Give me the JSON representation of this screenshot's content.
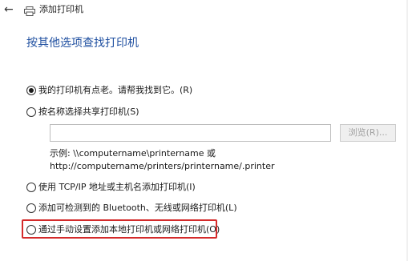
{
  "window": {
    "title": "添加打印机",
    "back_icon": "back-arrow-icon",
    "printer_icon": "printer-icon"
  },
  "heading": "按其他选项查找打印机",
  "options": [
    {
      "label": "我的打印机有点老。请帮我找到它。(R)",
      "checked": true
    },
    {
      "label": "按名称选择共享打印机(S)",
      "checked": false
    },
    {
      "label": "使用 TCP/IP 地址或主机名添加打印机(I)",
      "checked": false
    },
    {
      "label": "添加可检测到的 Bluetooth、无线或网络打印机(L)",
      "checked": false
    },
    {
      "label": "通过手动设置添加本地打印机或网络打印机(O)",
      "checked": false
    }
  ],
  "shared_printer": {
    "input_value": "",
    "browse_label": "浏览(R)...",
    "example_line1": "示例: \\\\computername\\printername 或",
    "example_line2": "http://computername/printers/printername/.printer"
  },
  "colors": {
    "heading": "#1f4fa0",
    "highlight": "#d42a2a"
  }
}
